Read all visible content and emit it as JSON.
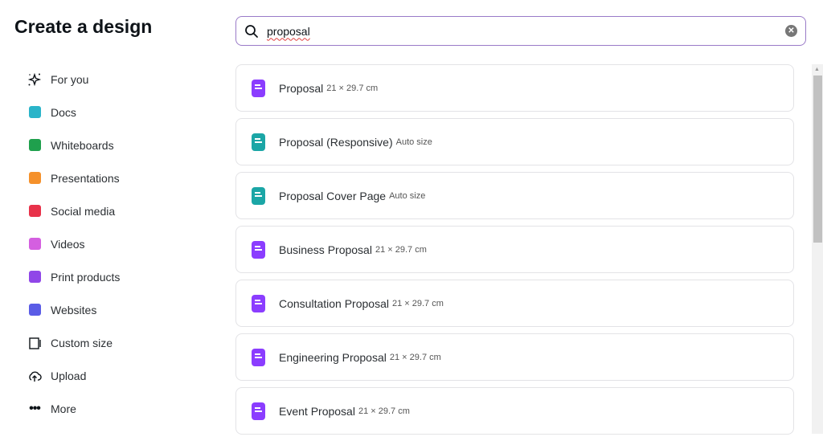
{
  "title": "Create a design",
  "sidebar": {
    "items": [
      {
        "label": "For you",
        "icon": "sparkle-icon"
      },
      {
        "label": "Docs",
        "icon": "docs-icon",
        "color": "#2ab4c9"
      },
      {
        "label": "Whiteboards",
        "icon": "whiteboard-icon",
        "color": "#1fa04d"
      },
      {
        "label": "Presentations",
        "icon": "presentation-icon",
        "color": "#f5912b"
      },
      {
        "label": "Social media",
        "icon": "heart-icon",
        "color": "#e8324a"
      },
      {
        "label": "Videos",
        "icon": "video-icon",
        "color": "#d45fe0"
      },
      {
        "label": "Print products",
        "icon": "printer-icon",
        "color": "#9046e8"
      },
      {
        "label": "Websites",
        "icon": "website-icon",
        "color": "#5a5ce6"
      },
      {
        "label": "Custom size",
        "icon": "resize-icon"
      },
      {
        "label": "Upload",
        "icon": "cloud-upload-icon"
      },
      {
        "label": "More",
        "icon": "more-icon"
      }
    ]
  },
  "search": {
    "value": "proposal"
  },
  "results": [
    {
      "name": "Proposal",
      "size": "21 × 29.7 cm",
      "color": "#8b3dff"
    },
    {
      "name": "Proposal (Responsive)",
      "size": "Auto size",
      "color": "#1ba6a6"
    },
    {
      "name": "Proposal Cover Page",
      "size": "Auto size",
      "color": "#1ba6a6"
    },
    {
      "name": "Business Proposal",
      "size": "21 × 29.7 cm",
      "color": "#8b3dff"
    },
    {
      "name": "Consultation Proposal",
      "size": "21 × 29.7 cm",
      "color": "#8b3dff"
    },
    {
      "name": "Engineering Proposal",
      "size": "21 × 29.7 cm",
      "color": "#8b3dff"
    },
    {
      "name": "Event Proposal",
      "size": "21 × 29.7 cm",
      "color": "#8b3dff"
    }
  ]
}
